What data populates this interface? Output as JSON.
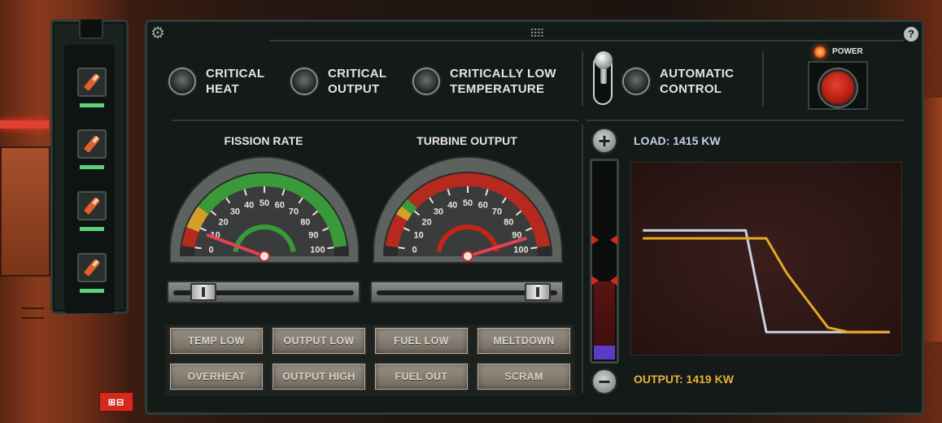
{
  "toolbar": {
    "tools": [
      {
        "icon": "wrench-icon",
        "status_color": "#5ed07a"
      },
      {
        "icon": "wrench-icon",
        "status_color": "#5ed07a"
      },
      {
        "icon": "wrench-icon",
        "status_color": "#5ed07a"
      },
      {
        "icon": "wrench-icon",
        "status_color": "#5ed07a"
      }
    ]
  },
  "alarms": [
    {
      "label_1": "CRITICAL",
      "label_2": "HEAT"
    },
    {
      "label_1": "CRITICAL",
      "label_2": "OUTPUT"
    },
    {
      "label_1": "CRITICALLY LOW",
      "label_2": "TEMPERATURE"
    }
  ],
  "automatic_control": {
    "label_1": "AUTOMATIC",
    "label_2": "CONTROL"
  },
  "power": {
    "label": "POWER",
    "button_color": "#c42418"
  },
  "gauges": {
    "fission": {
      "title": "FISSION RATE",
      "ticks": [
        "0",
        "10",
        "20",
        "30",
        "40",
        "50",
        "60",
        "70",
        "80",
        "90",
        "100"
      ],
      "needle_value": 8,
      "slider_value": 0.12
    },
    "turbine": {
      "title": "TURBINE OUTPUT",
      "ticks": [
        "0",
        "10",
        "20",
        "30",
        "40",
        "50",
        "60",
        "70",
        "80",
        "90",
        "100"
      ],
      "needle_value": 94,
      "slider_value": 0.95
    }
  },
  "warnings": [
    [
      "TEMP LOW",
      "OUTPUT LOW",
      "FUEL LOW",
      "MELTDOWN"
    ],
    [
      "OVERHEAT",
      "OUTPUT HIGH",
      "FUEL OUT",
      "SCRAM"
    ]
  ],
  "control_rods": {
    "plus": "+",
    "minus": "−",
    "level": 0.07
  },
  "readouts": {
    "load": "LOAD: 1415 KW",
    "output": "OUTPUT: 1419 KW"
  },
  "chart_data": {
    "type": "line",
    "x": [
      0,
      1,
      2,
      3,
      4,
      5,
      6,
      7,
      8,
      9,
      10,
      11,
      12
    ],
    "series": [
      {
        "values": [
          1.0,
          1.0,
          1.0,
          1.0,
          1.0,
          1.0,
          0.1,
          0.1,
          0.1,
          0.1,
          0.1,
          0.1,
          0.1
        ],
        "color": "#c8d2e2"
      },
      {
        "values": [
          0.93,
          0.93,
          0.93,
          0.93,
          0.93,
          0.93,
          0.93,
          0.62,
          0.38,
          0.14,
          0.1,
          0.1,
          0.1
        ],
        "color": "#e6a824"
      }
    ],
    "ylim": [
      0,
      1.5
    ]
  }
}
